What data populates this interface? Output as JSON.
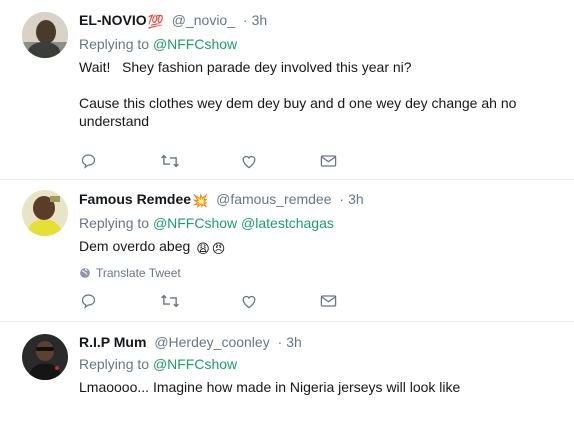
{
  "tweets": [
    {
      "name": "EL-NOVIO",
      "name_emoji": "💯",
      "handle": "@_novio_",
      "dot": "·",
      "time": "3h",
      "reply_prefix": "Replying to",
      "reply_to_1": "@NFFCshow",
      "reply_to_2": "",
      "body": "Wait!   Shey fashion parade dey involved this year ni?\n\nCause this clothes wey dem dey buy and d one wey dey change ah no understand",
      "translate": ""
    },
    {
      "name": "Famous Remdee",
      "name_emoji": "💥",
      "handle": "@famous_remdee",
      "dot": "·",
      "time": "3h",
      "reply_prefix": "Replying to",
      "reply_to_1": "@NFFCshow",
      "reply_to_2": "@latestchagas",
      "body": "Dem overdo abeg",
      "body_emojis": [
        "😩",
        "😠"
      ],
      "translate": "Translate Tweet"
    },
    {
      "name": "R.I.P Mum",
      "name_emoji": "",
      "handle": "@Herdey_coonley",
      "dot": "·",
      "time": "3h",
      "reply_prefix": "Replying to",
      "reply_to_1": "@NFFCshow",
      "reply_to_2": "",
      "body": "Lmaoooo... Imagine how made in Nigeria jerseys will look like",
      "translate": ""
    }
  ],
  "icons": {
    "reply": "reply-icon",
    "retweet": "retweet-icon",
    "like": "heart-icon",
    "dm": "envelope-icon",
    "globe": "globe-icon"
  },
  "colors": {
    "mention": "#1c9d6b",
    "secondary_text": "#657786",
    "icon": "#657786",
    "divider": "#e6ecf0"
  }
}
